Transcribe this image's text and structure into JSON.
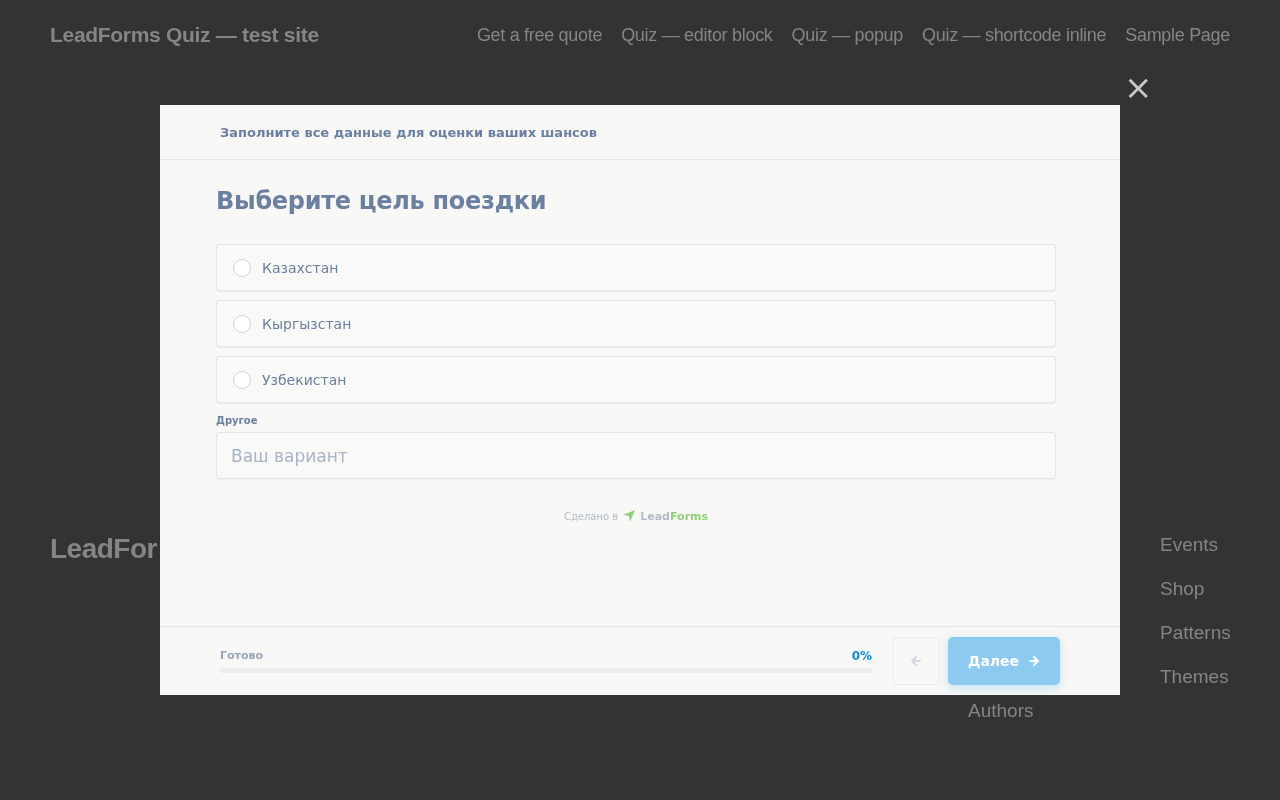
{
  "site": {
    "title": "LeadForms Quiz — test site",
    "nav": [
      "Get a free quote",
      "Quiz — editor block",
      "Quiz — popup",
      "Quiz — shortcode inline",
      "Sample Page"
    ],
    "footer_title": "LeadFor",
    "footer_column_1": [
      "Authors"
    ],
    "footer_column_2": [
      "Events",
      "Shop",
      "Patterns",
      "Themes"
    ]
  },
  "quiz": {
    "close": "×",
    "header": "Заполните все данные для оценки ваших шансов",
    "question": "Выберите цель поездки",
    "options": [
      {
        "label": "Казахстан",
        "selected": false
      },
      {
        "label": "Кыргызстан",
        "selected": false
      },
      {
        "label": "Узбекистан",
        "selected": false
      }
    ],
    "other": {
      "label": "Другое",
      "placeholder": "Ваш вариант"
    },
    "credit": {
      "text": "Сделано в",
      "brand_1": "Lead",
      "brand_2": "Forms"
    },
    "progress": {
      "label": "Готово",
      "reading": "0%",
      "level": 0
    },
    "next": "Далее"
  }
}
